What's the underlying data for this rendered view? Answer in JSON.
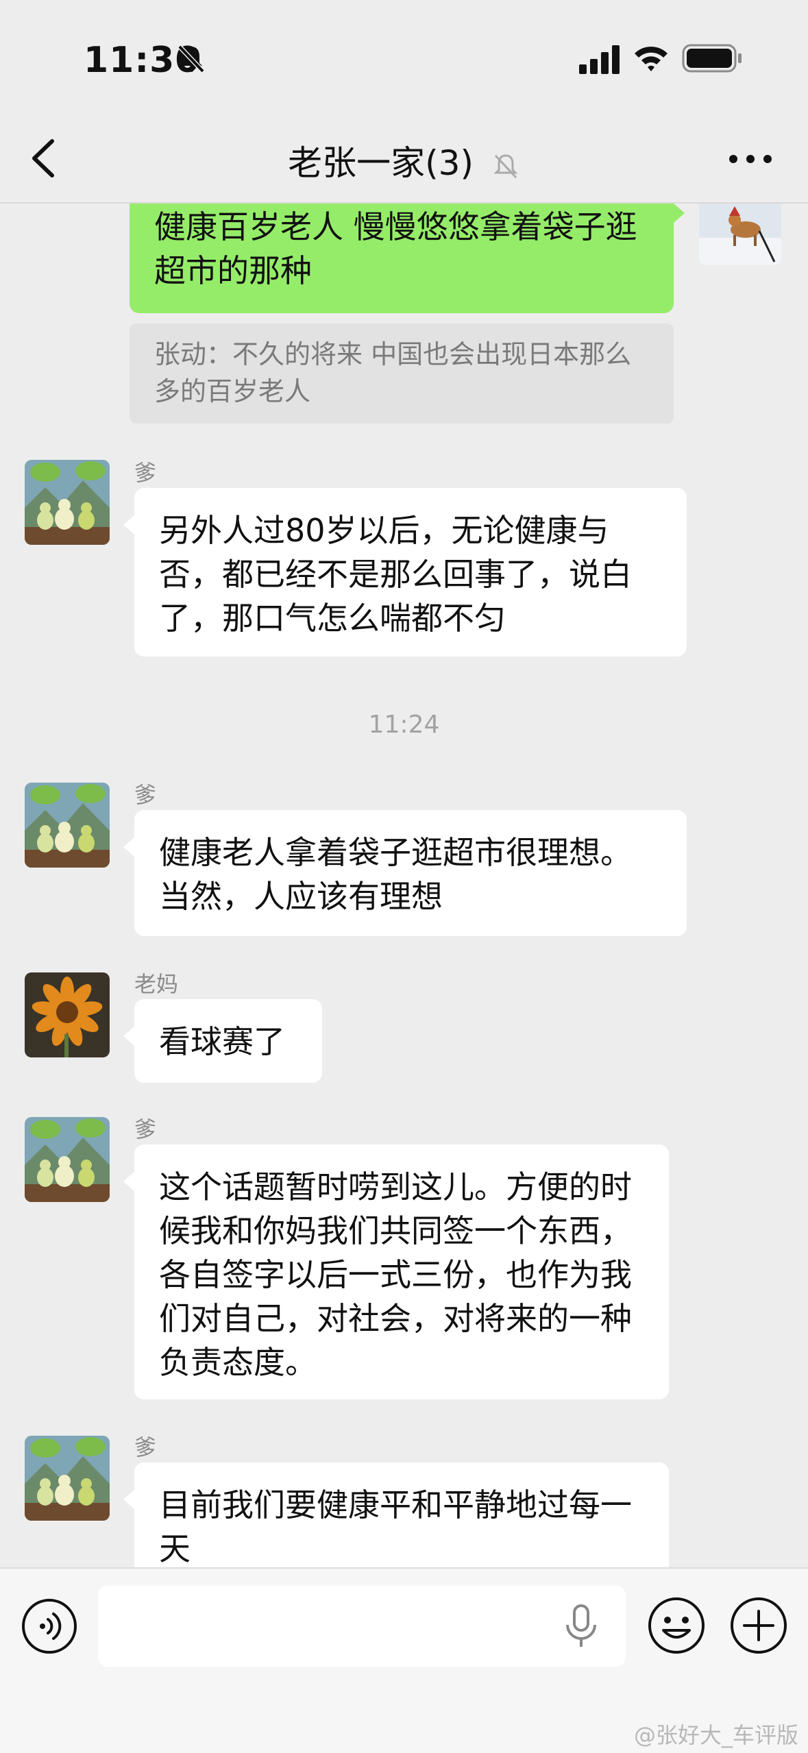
{
  "status_bar": {
    "time": "11:30"
  },
  "header": {
    "title": "老张一家(3)"
  },
  "messages": [
    {
      "type": "outgoing",
      "text": "健康百岁老人 慢慢悠悠拿着袋子逛超市的那种"
    },
    {
      "type": "quote",
      "text": "张动：不久的将来 中国也会出现日本那么多的百岁老人"
    },
    {
      "type": "incoming",
      "sender": "爹",
      "text": "另外人过80岁以后，无论健康与否，都已经不是那么回事了，说白了，那口气怎么喘都不匀"
    },
    {
      "type": "timestamp",
      "text": "11:24"
    },
    {
      "type": "incoming",
      "sender": "爹",
      "text": "健康老人拿着袋子逛超市很理想。当然，人应该有理想"
    },
    {
      "type": "incoming",
      "sender": "老妈",
      "text": "看球赛了"
    },
    {
      "type": "incoming",
      "sender": "爹",
      "text": "这个话题暂时唠到这儿。方便的时候我和你妈我们共同签一个东西，各自签字以后一式三份，也作为我们对自己，对社会，对将来的一种负责态度。"
    },
    {
      "type": "incoming",
      "sender": "爹",
      "text": "目前我们要健康平和平静地过每一天"
    }
  ],
  "input_bar": {
    "text_value": "",
    "watermark": "@张好大_车评版"
  },
  "icons": [
    "bell-off-icon",
    "signal-icon",
    "wifi-icon",
    "battery-icon",
    "back-icon",
    "mute-icon",
    "more-icon",
    "voice-icon",
    "mic-icon",
    "emoji-icon",
    "plus-icon"
  ],
  "colors": {
    "background": "#ededed",
    "outgoing_bubble": "#95ec69",
    "incoming_bubble": "#ffffff",
    "quote_bg": "#e2e2e2"
  }
}
